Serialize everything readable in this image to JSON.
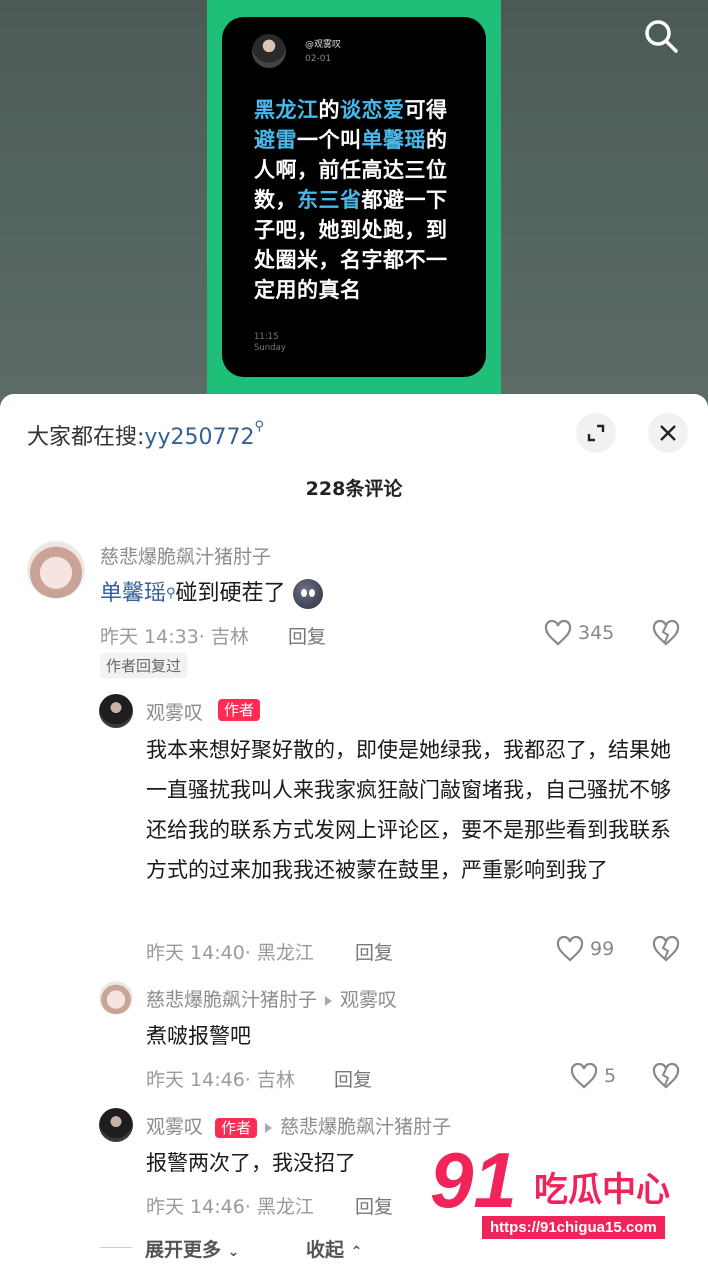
{
  "video": {
    "card_handle": "@观雾叹",
    "card_date": "02-01",
    "card_text_segments": [
      {
        "t": "黑龙江",
        "hl": true
      },
      {
        "t": "的",
        "hl": false
      },
      {
        "t": "谈恋爱",
        "hl": true
      },
      {
        "t": "可得",
        "hl": false
      },
      {
        "t": "避雷",
        "hl": true
      },
      {
        "t": "一个叫",
        "hl": false
      },
      {
        "t": "单馨瑶",
        "hl": true
      },
      {
        "t": "的人啊，前任高达三位数，",
        "hl": false
      },
      {
        "t": "东三省",
        "hl": true
      },
      {
        "t": "都避一下子吧，她到处跑，到处圈米，名字都不一定用的真名",
        "hl": false
      }
    ],
    "card_time": "11:15",
    "card_day": "Sunday",
    "accent_color": "#1fbf7a"
  },
  "sheet": {
    "trend_prefix": "大家都在搜:",
    "trend_keyword": "yy250772",
    "comment_count": "228条评论",
    "expand_label": "展开更多",
    "collapse_label": "收起"
  },
  "comments": [
    {
      "user": "慈悲爆脆飙汁猪肘子",
      "text_link": "单馨瑶",
      "text_rest": "碰到硬茬了",
      "time": "昨天 14:33",
      "location": "吉林",
      "reply_label": "回复",
      "likes": "345",
      "tag": "作者回复过"
    },
    {
      "user": "观雾叹",
      "author_badge": "作者",
      "text": "我本来想好聚好散的，即使是她绿我，我都忍了，结果她一直骚扰我叫人来我家疯狂敲门敲窗堵我，自己骚扰不够还给我的联系方式发网上评论区，要不是那些看到我联系方式的过来加我我还被蒙在鼓里，严重影响到我了",
      "time": "昨天 14:40",
      "location": "黑龙江",
      "reply_label": "回复",
      "likes": "99"
    },
    {
      "user": "慈悲爆脆飙汁猪肘子",
      "reply_to": "观雾叹",
      "text": "煮啵报警吧",
      "time": "昨天 14:46",
      "location": "吉林",
      "reply_label": "回复",
      "likes": "5"
    },
    {
      "user": "观雾叹",
      "author_badge": "作者",
      "reply_to": "慈悲爆脆飙汁猪肘子",
      "text": "报警两次了，我没招了",
      "time": "昨天 14:46",
      "location": "黑龙江",
      "reply_label": "回复"
    }
  ],
  "watermark": {
    "number": "91",
    "brand": "吃瓜中心",
    "url": "https://91chigua15.com"
  }
}
